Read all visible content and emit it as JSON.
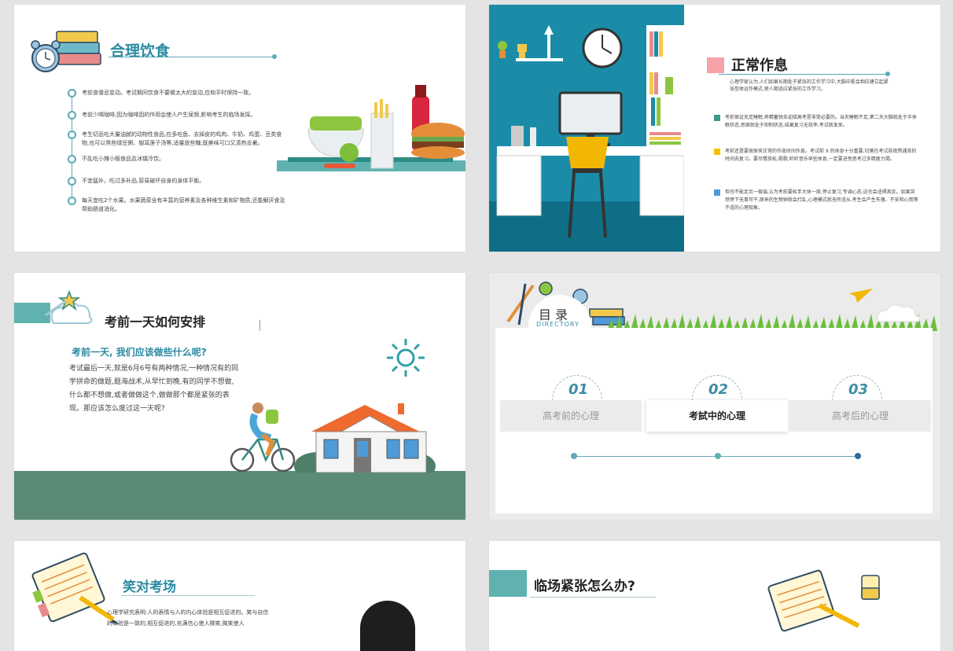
{
  "slide1": {
    "title": "合理饮食",
    "items": [
      "考前食谱忌变动。考试期间饮食不要做太大的变动,应和平时保持一致。",
      "考前少喝咖啡,因为咖啡因的作用会使人产生尿频,影响考生的临场发挥。",
      "考生切忌吃大量油腻的动物性食品,应多吃鱼、去掉皮的鸡肉、牛奶、鸡蛋、豆类食物,也可以熬些绿豆粥、银耳莲子汤等,适量放些糖,既美味可口又清热去暑。",
      "不乱吃小摊小贩食品及冰镇冷饮。",
      "不宜猛补。吃过多补品,容易破坏自身的身体平衡。",
      "每天宜吃2个水果。水果蔬菜含有丰富的营养素及各种维生素和矿物质,还能解厌食及帮助肠道消化。"
    ]
  },
  "slide2": {
    "title": "正常作息",
    "intro": "心理学家认为,人们如果长期处于紧张的工作学习中,大脑中枢会相应建立起紧张型体运作模式,使人期适应紧张的工作学习。",
    "points": [
      {
        "color": "#3a9a8a",
        "text": "考前保证充足睡眠,养精蓄锐去迎接高考是非常必要的。当天睡眠不足,第二天大脑就处于半休眠状态,思维就处于抑制状态,结果复习无效率,考试就发呆。"
      },
      {
        "color": "#f2c200",
        "text": "考前还是要按原来正常的作息时间作息。考试前 9 的休息十分重要,切莫在考试前夜熬通宵的时间去复习。要尽情放松,歌歌,听听音乐早些休息,一定要进免思考过多精疲力竭。"
      },
      {
        "color": "#4f9ad8",
        "text": "但也不能走另一极端,认为考前要松手大休一周,停止复习,专调心态,这也会适得其反。如果突然停下无事可干,原来的生物钟就会打乱,心理模式就无所适从,考生会产生失落、不安和心慌等不适的心理现象。"
      }
    ]
  },
  "slide3": {
    "title": "考前一天如何安排",
    "subtitle": "考前一天, 我们应该做些什么呢?",
    "body": "考试最后一天,就是6月6号有两种情况,一种情况有的同学拼命的做题,题海战术,从早忙到晚,有的同学不想做,什么都不想做,或者做做这个,做做那个都是紧张的表现。那应该怎么度过这一天呢?"
  },
  "slide4": {
    "title": "目 录",
    "subtitle": "DIRECTORY",
    "tabs": [
      {
        "num": "01",
        "label": "高考前的心理"
      },
      {
        "num": "02",
        "label": "考試中的心理"
      },
      {
        "num": "03",
        "label": "高考后的心理"
      }
    ]
  },
  "slide5": {
    "title": "笑对考场",
    "body": "心理学研究表明:人的表情与人的内心体验是相互促进的。笑与自信的体验是一致的,相互促进的,充满信心使人微笑,微笑使人"
  },
  "slide6": {
    "title": "临场紧张怎么办?"
  },
  "colors": {
    "teal": "#2a8aa2",
    "ground": "#5a8b76",
    "office_bg": "#1a8ca8"
  }
}
